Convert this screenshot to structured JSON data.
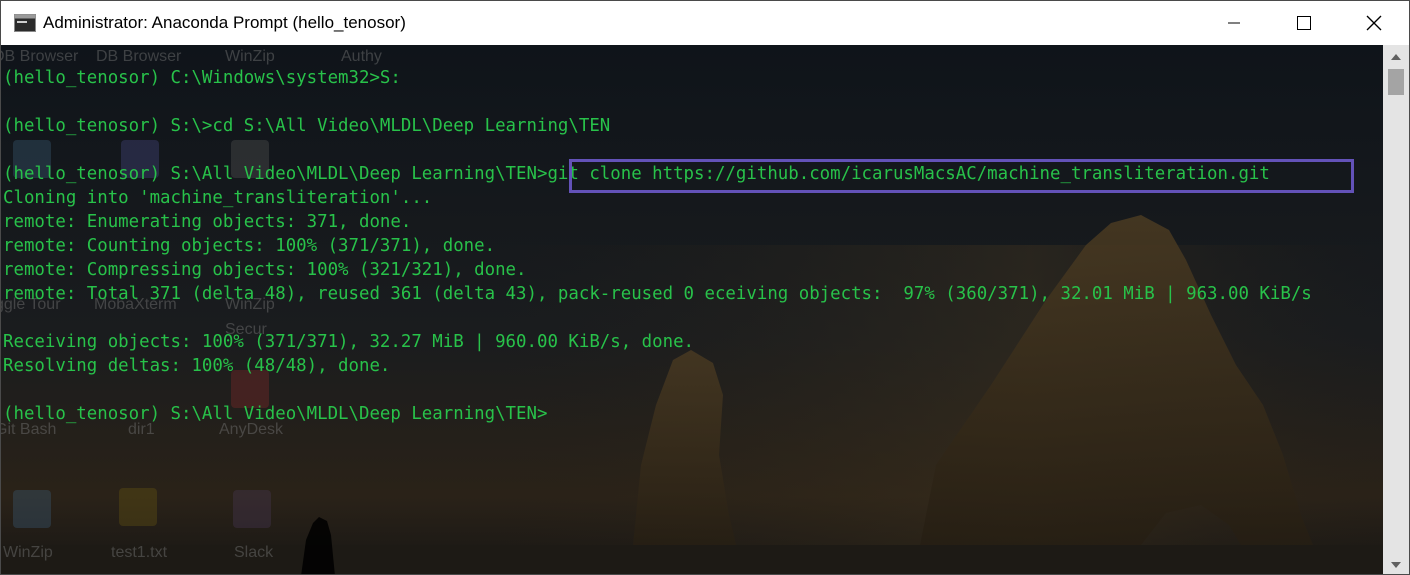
{
  "window": {
    "title": "Administrator: Anaconda Prompt (hello_tenosor)",
    "accent_highlight": "#6352b8",
    "text_color": "#28c24a"
  },
  "desktop_labels": {
    "dbbrowser1": "DB Browser",
    "dbbrowser2": "DB Browser",
    "winzip_top": "WinZip",
    "authy": "Authy",
    "toggle": "ggle  Tour",
    "mobaxterm": "MobaXterm",
    "winzip_secur": "WinZip",
    "secur": "Secur",
    "gitbash": "Git Bash",
    "dir1": "dir1",
    "anydesk": "AnyDesk",
    "winzip_bottom": "WinZip",
    "test1": "test1.txt",
    "slack": "Slack"
  },
  "terminal": {
    "lines": [
      "(hello_tenosor) C:\\Windows\\system32>S:",
      "",
      "(hello_tenosor) S:\\>cd S:\\All Video\\MLDL\\Deep Learning\\TEN",
      "",
      "(hello_tenosor) S:\\All Video\\MLDL\\Deep Learning\\TEN>git clone https://github.com/icarusMacsAC/machine_transliteration.git",
      "Cloning into 'machine_transliteration'...",
      "remote: Enumerating objects: 371, done.",
      "remote: Counting objects: 100% (371/371), done.",
      "remote: Compressing objects: 100% (321/321), done.",
      "remote: Total 371 (delta 48), reused 361 (delta 43), pack-reused 0 eceiving objects:  97% (360/371), 32.01 MiB | 963.00 KiB/s",
      "",
      "Receiving objects: 100% (371/371), 32.27 MiB | 960.00 KiB/s, done.",
      "Resolving deltas: 100% (48/48), done.",
      "",
      "(hello_tenosor) S:\\All Video\\MLDL\\Deep Learning\\TEN>"
    ]
  }
}
